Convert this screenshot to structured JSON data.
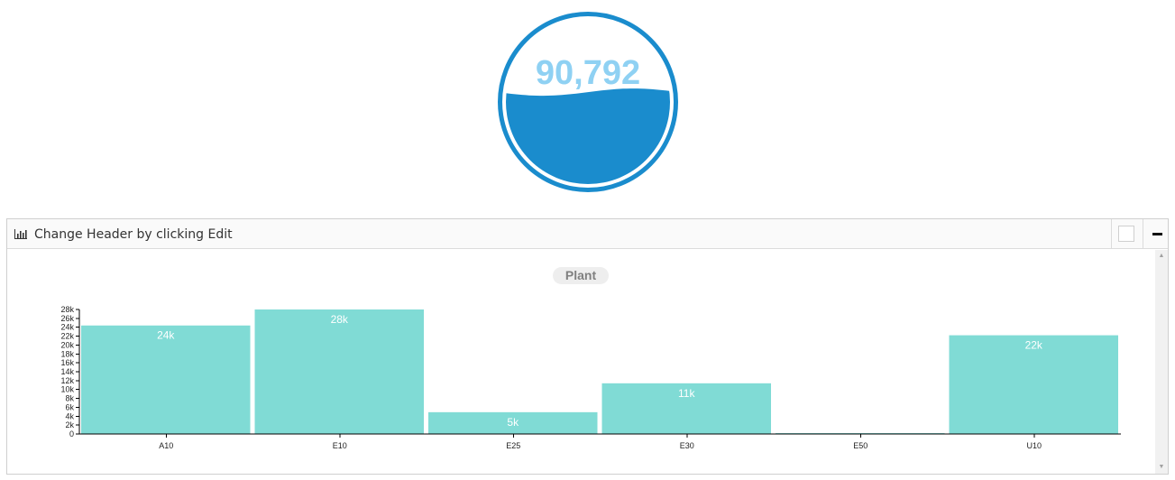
{
  "gauge": {
    "value_text": "90,792",
    "fill_fraction": 0.56,
    "colors": {
      "ring": "#1a8ccd",
      "fill": "#1a8ccd",
      "text": "#8fd1f3"
    }
  },
  "panel": {
    "title": "Change Header by clicking Edit",
    "icons": {
      "header": "bar-chart-icon",
      "minimize": "minus-icon",
      "scroll_up": "caret-up-icon",
      "scroll_down": "caret-down-icon"
    }
  },
  "chart_data": {
    "type": "bar",
    "title": "Plant",
    "categories": [
      "A10",
      "E10",
      "E25",
      "E30",
      "E50",
      "U10"
    ],
    "values": [
      24400,
      28000,
      4900,
      11400,
      200,
      22200
    ],
    "data_labels": [
      "24k",
      "28k",
      "5k",
      "11k",
      "",
      "22k"
    ],
    "ylim": [
      0,
      28000
    ],
    "yticks": [
      "0",
      "2k",
      "4k",
      "6k",
      "8k",
      "10k",
      "12k",
      "14k",
      "16k",
      "18k",
      "20k",
      "22k",
      "24k",
      "26k",
      "28k"
    ],
    "bar_color": "#80dbd5",
    "xlabel": "",
    "ylabel": ""
  }
}
